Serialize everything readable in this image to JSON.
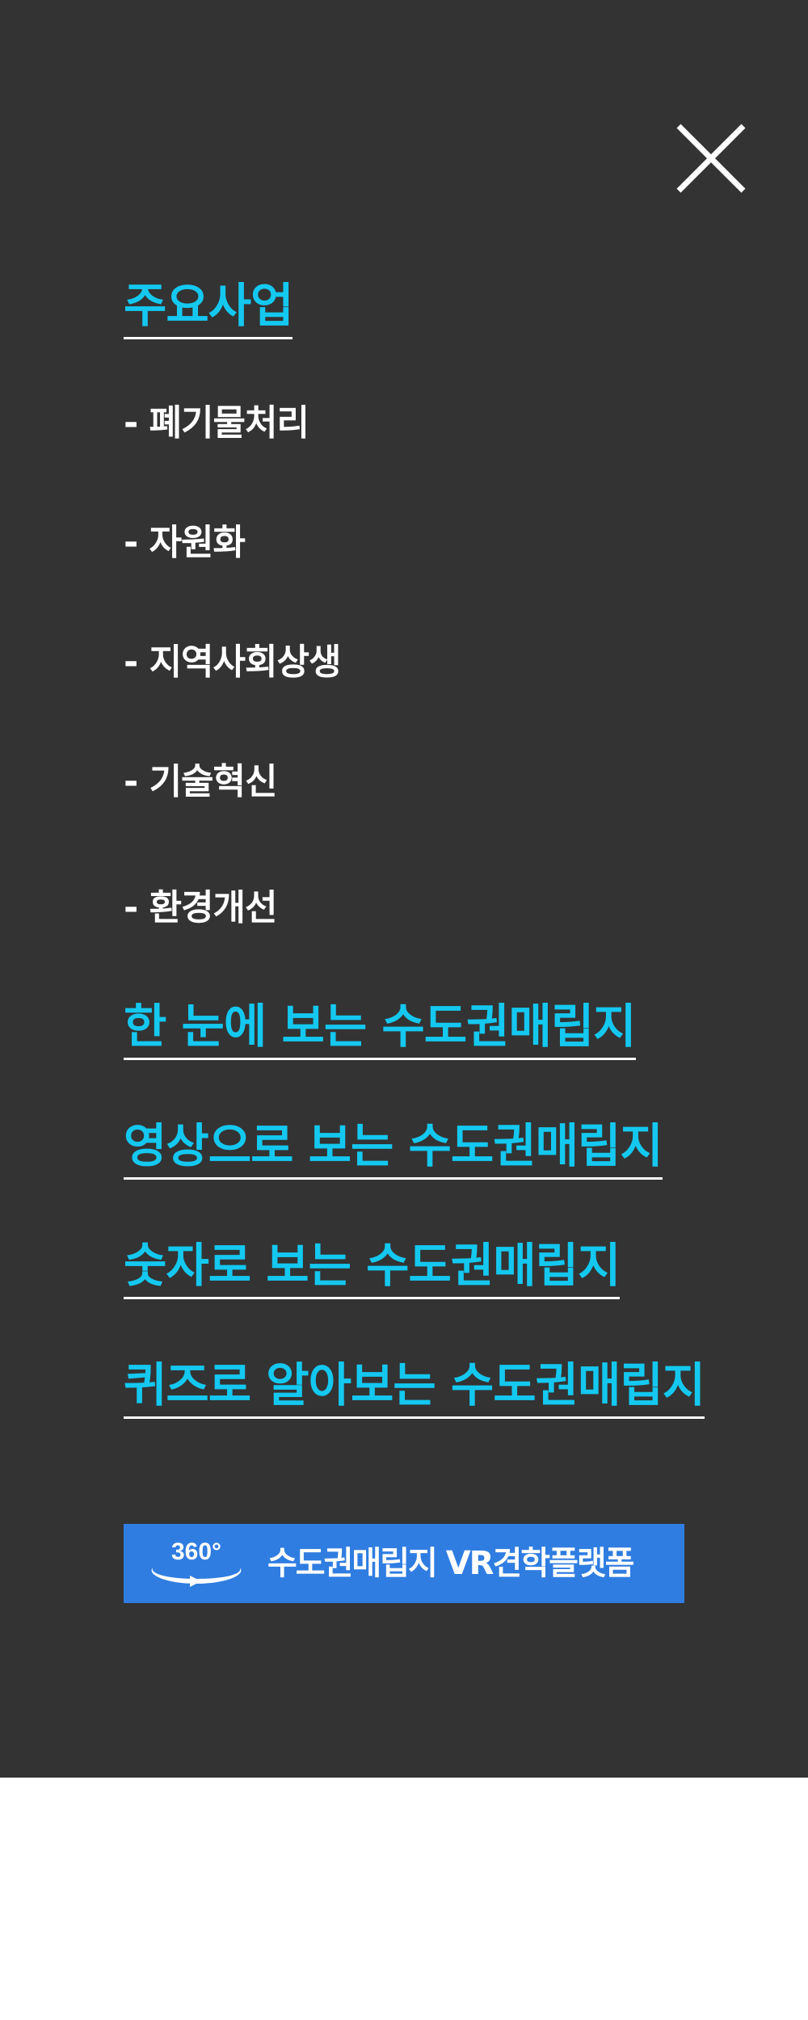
{
  "menu": {
    "close_icon": "close-icon",
    "sections": [
      {
        "label": "주요사업"
      },
      {
        "label": "한 눈에 보는 수도권매립지"
      },
      {
        "label": "영상으로 보는 수도권매립지"
      },
      {
        "label": "숫자로 보는 수도권매립지"
      },
      {
        "label": "퀴즈로 알아보는 수도권매립지"
      }
    ],
    "sub_items": [
      {
        "label": "- 폐기물처리"
      },
      {
        "label": "- 자원화"
      },
      {
        "label": "- 지역사회상생"
      },
      {
        "label": "- 기술혁신"
      },
      {
        "label": "- 환경개선"
      }
    ],
    "vr_banner": {
      "badge": "360°",
      "label": "수도권매립지 VR견학플랫폼",
      "icon": "360-rotate-icon"
    }
  },
  "colors": {
    "panel_background": "#333333",
    "section_link": "#14c8f0",
    "sub_item": "#ffffff",
    "banner_background": "#2f7de1",
    "page_background": "#ffffff"
  }
}
